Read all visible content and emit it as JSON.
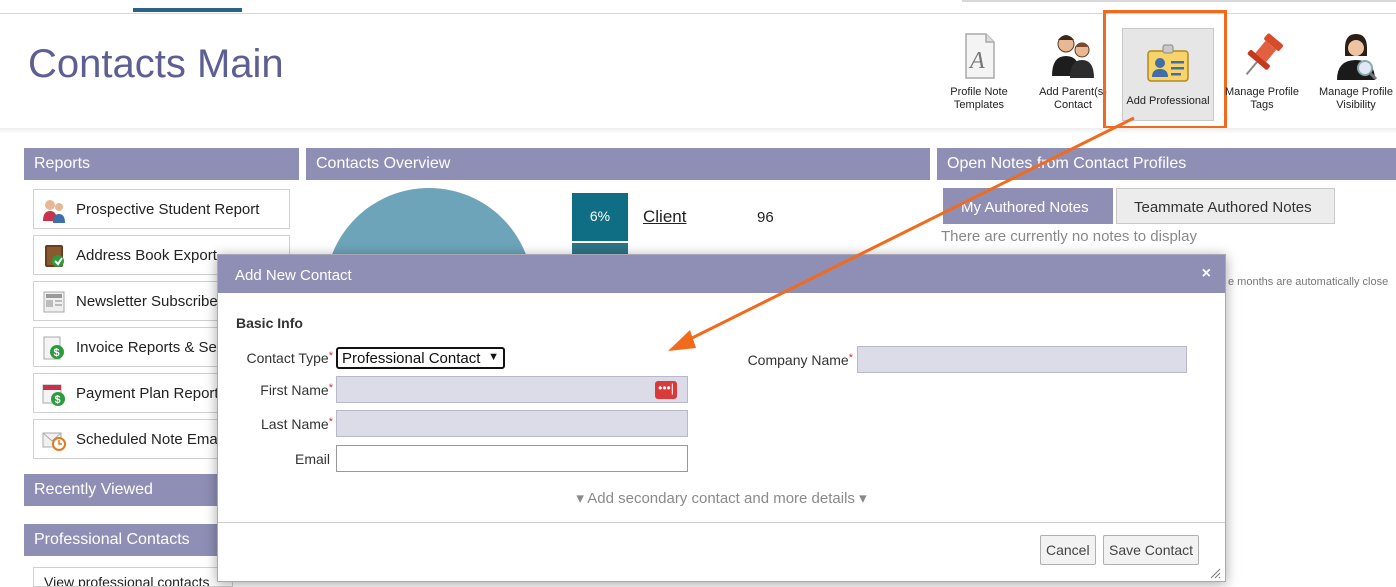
{
  "header": {
    "title": "Contacts Main"
  },
  "toolbar": {
    "items": [
      {
        "label": "Profile Note Templates",
        "icon": "document-a-icon"
      },
      {
        "label": "Add Parent(s) Contact",
        "icon": "parents-icon"
      },
      {
        "label": "Add Professional",
        "icon": "id-card-icon"
      },
      {
        "label": "Manage Profile Tags",
        "icon": "pin-icon"
      },
      {
        "label": "Manage Profile Visibility",
        "icon": "person-search-icon"
      }
    ]
  },
  "reports": {
    "title": "Reports",
    "items": [
      {
        "label": "Prospective Student Report"
      },
      {
        "label": "Address Book Export"
      },
      {
        "label": "Newsletter Subscribers"
      },
      {
        "label": "Invoice Reports & Settings"
      },
      {
        "label": "Payment Plan Reports"
      },
      {
        "label": "Scheduled Note Emails"
      }
    ]
  },
  "recently_viewed": {
    "title": "Recently Viewed"
  },
  "professional_contacts": {
    "title": "Professional Contacts",
    "link": "View professional contacts"
  },
  "overview": {
    "title": "Contacts Overview",
    "row": {
      "percent": "6%",
      "label": "Client",
      "count": "96"
    }
  },
  "notes": {
    "title": "Open Notes from Contact Profiles",
    "tabs": [
      {
        "label": "My Authored Notes"
      },
      {
        "label": "Teammate Authored Notes"
      }
    ],
    "empty": "There are currently no notes to display",
    "auto_close": "e months are automatically close"
  },
  "modal": {
    "title": "Add New Contact",
    "close": "×",
    "section": "Basic Info",
    "fields": {
      "contact_type_label": "Contact Type",
      "contact_type_value": "Professional Contact",
      "first_name_label": "First Name",
      "last_name_label": "Last Name",
      "email_label": "Email",
      "company_name_label": "Company Name",
      "required_marker": "*"
    },
    "secondary": "▾ Add secondary contact and more details ▾",
    "buttons": {
      "cancel": "Cancel",
      "save": "Save Contact"
    }
  },
  "colors": {
    "accent": "#8f8fb5",
    "title": "#5d5f94",
    "highlight": "#f26a1b",
    "teal": "#0f6e84"
  }
}
